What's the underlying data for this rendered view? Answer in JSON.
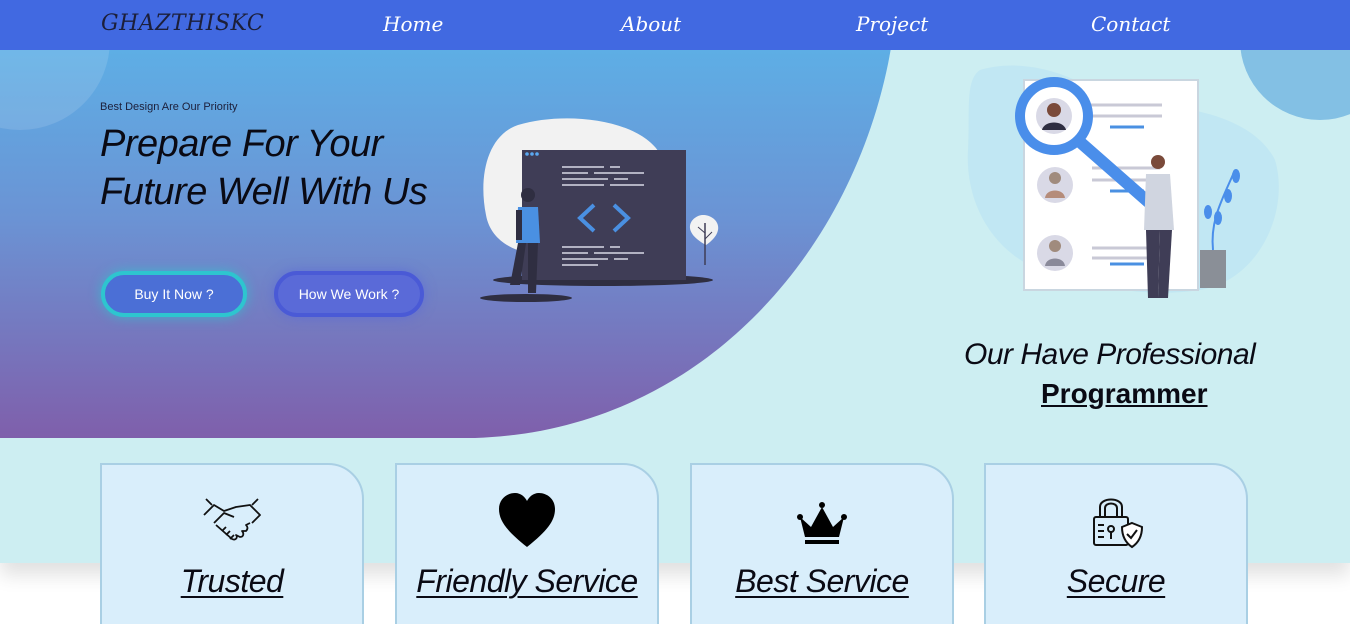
{
  "navbar": {
    "brand": "GHAZTHISKC",
    "links": [
      "Home",
      "About",
      "Project",
      "Contact"
    ]
  },
  "hero": {
    "subtitle": "Best Design Are Our Priority",
    "title": "Prepare For Your Future Well With Us",
    "buttons": {
      "buy": "Buy It Now ?",
      "how": "How We Work ?"
    }
  },
  "programmer": {
    "line1": "Our Have Professional",
    "line2": "Programmer"
  },
  "features": [
    {
      "title": "Trusted",
      "icon": "handshake-icon"
    },
    {
      "title": "Friendly Service",
      "icon": "heart-icon"
    },
    {
      "title": "Best Service",
      "icon": "crown-icon"
    },
    {
      "title": "Secure",
      "icon": "padlock-shield-icon"
    }
  ],
  "colors": {
    "navbar": "#4169e1",
    "section_bg": "#cdeef2",
    "gradient_top": "#5ab4e8",
    "gradient_bottom": "#7e60ad",
    "card_bg": "#d9eefb"
  }
}
